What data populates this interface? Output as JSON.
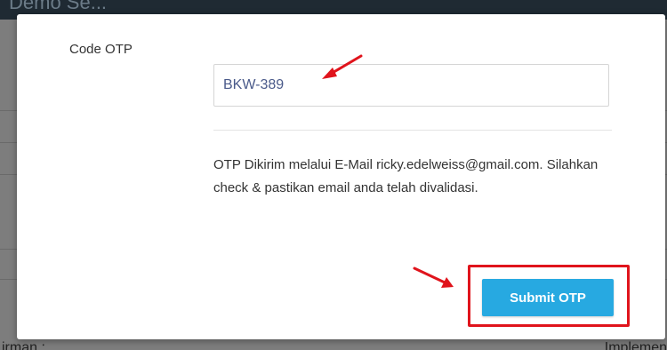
{
  "background": {
    "title_fragment": "Demo Se...",
    "bottom_left_text": "irman :",
    "bottom_right_text": "Implemen"
  },
  "modal": {
    "otp_label": "Code OTP",
    "otp_input_value": "BKW-389",
    "info_text": "OTP Dikirim melalui E-Mail ricky.edelweiss@gmail.com. Silahkan check & pastikan email anda telah divalidasi.",
    "submit_label": "Submit OTP"
  },
  "colors": {
    "submit_button": "#27a9e1",
    "annotation_red": "#e0141c",
    "header_dark": "#1f2a33"
  },
  "annotations": {
    "arrow_icon": "red-arrow-icon",
    "highlight_box": "red-highlight-box"
  }
}
